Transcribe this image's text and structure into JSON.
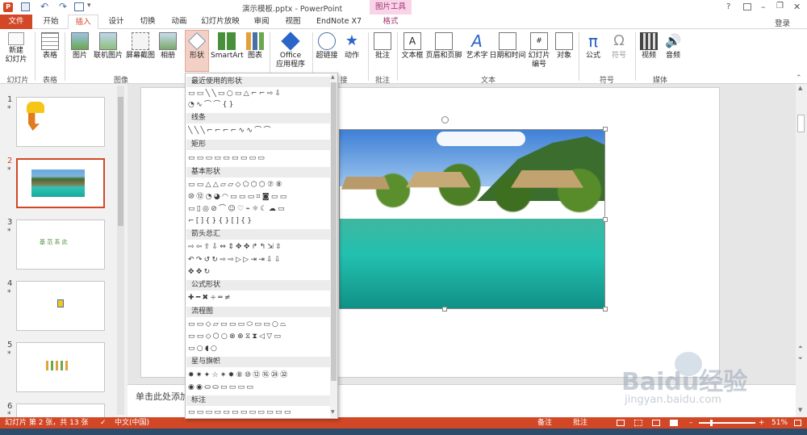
{
  "window": {
    "title": "演示模板.pptx - PowerPoint",
    "context_tab_group": "图片工具",
    "signin": "登录",
    "help": "?",
    "minimize": "–",
    "restore": "❐",
    "close": "✕"
  },
  "tabs": [
    {
      "label": "文件"
    },
    {
      "label": "开始"
    },
    {
      "label": "插入"
    },
    {
      "label": "设计"
    },
    {
      "label": "切换"
    },
    {
      "label": "动画"
    },
    {
      "label": "幻灯片放映"
    },
    {
      "label": "审阅"
    },
    {
      "label": "视图"
    },
    {
      "label": "EndNote X7"
    },
    {
      "label": "格式"
    }
  ],
  "ribbon": {
    "buttons": {
      "new_slide": "新建\n幻灯片",
      "table": "表格",
      "picture": "图片",
      "online_picture": "联机图片",
      "screenshot": "屏幕截图",
      "album": "相册",
      "shapes": "形状",
      "smartart": "SmartArt",
      "chart": "图表",
      "office_apps": "Office\n应用程序",
      "hyperlink": "超链接",
      "action": "动作",
      "comment": "批注",
      "textbox": "文本框",
      "header_footer": "页眉和页脚",
      "wordart": "艺术字",
      "datetime": "日期和时间",
      "slide_number": "幻灯片\n编号",
      "object": "对象",
      "equation": "公式",
      "symbol": "符号",
      "video": "视频",
      "audio": "音频"
    },
    "groups": {
      "slides": "幻灯片",
      "tables": "表格",
      "images": "图像",
      "links": "接",
      "comments": "批注",
      "text": "文本",
      "symbols": "符号",
      "media": "媒体"
    }
  },
  "shape_gallery": {
    "sections": [
      {
        "label": "最近使用的形状",
        "rows": [
          "▭▭╲╲▭○▭△⌐⌐⇨⇩",
          "◔∿⌒⌒{}"
        ]
      },
      {
        "label": "线条",
        "rows": [
          "╲╲╲⌐⌐⌐⌐∿∿⌒⌒"
        ]
      },
      {
        "label": "矩形",
        "rows": [
          "▭▭▭▭▭▭▭▭▭"
        ]
      },
      {
        "label": "基本形状",
        "rows": [
          "▭▭△△▱▱◇⬠⬡⬡⑦⑧",
          "⑩⑫◔◕◠▭▭▭⌗◙▭▭",
          "▭▯◎⊘⌒☺♡⌁☼☾☁▭",
          "⌐[]{}{}[]{}",
          "",
          ""
        ]
      },
      {
        "label": "箭头总汇",
        "rows": [
          "⇨⇦⇧⇩⇔⇕✥✥↱↰⇲⇳",
          "↶↷↺↻⇨⇨▷▷⇥⇥⇩⇩",
          "✥✥↻"
        ]
      },
      {
        "label": "公式形状",
        "rows": [
          "✚━✖÷═≠"
        ]
      },
      {
        "label": "流程图",
        "rows": [
          "▭▭◇▱▭▭▭⬭▭▭○⏢",
          "▭▭◇⬡○⊗⊕⧖⧗◁▽▭",
          "▭○◖○"
        ]
      },
      {
        "label": "星与旗帜",
        "rows": [
          "✸✷✦☆✶✹⑧⑩⑫⑯㉔㉜",
          "◉◉⛀⛀▭▭▭▭"
        ]
      },
      {
        "label": "标注",
        "rows": [
          "▭▭▭▭▭▭▭▭▭▭▭▭"
        ]
      }
    ]
  },
  "slides_pane": {
    "slides": [
      {
        "num": "1",
        "star": "*"
      },
      {
        "num": "2",
        "star": "*"
      },
      {
        "num": "3",
        "star": "*",
        "text": "基 范 系 此"
      },
      {
        "num": "4",
        "star": "*"
      },
      {
        "num": "5",
        "star": "*"
      },
      {
        "num": "6",
        "star": "*"
      }
    ]
  },
  "notes": {
    "placeholder": "单击此处添加"
  },
  "status": {
    "slide_info": "幻灯片 第 2 张，共 13 张",
    "language": "中文(中国)",
    "notes": "备注",
    "comments": "批注",
    "zoom": "51%"
  },
  "watermark": {
    "text": "Baidu经验",
    "url": "jingyan.baidu.com"
  },
  "colors": {
    "accent": "#d24726",
    "tab_file_bg": "#d24726",
    "context_tab_bg": "#f9d4e9"
  }
}
